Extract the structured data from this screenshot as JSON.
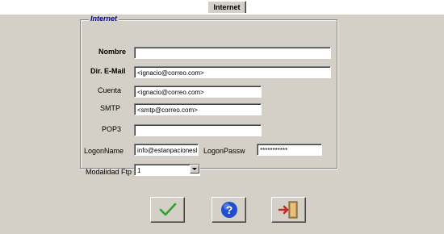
{
  "tab": {
    "label": "Internet"
  },
  "group": {
    "title": "Internet"
  },
  "fields": {
    "nombre": {
      "label": "Nombre",
      "value": ""
    },
    "email": {
      "label": "Dir. E-Mail",
      "value": "<ignacio@correo.com>"
    },
    "cuenta": {
      "label": "Cuenta",
      "value": "<ignacio@correo.com>"
    },
    "smtp": {
      "label": "SMTP",
      "value": "<smtp@correo.com>"
    },
    "pop3": {
      "label": "POP3",
      "value": ""
    },
    "logon_name": {
      "label": "LogonName",
      "value": "info@estanpacionesl"
    },
    "logon_passw": {
      "label": "LogonPassw",
      "value": "***********"
    },
    "modalidad_ftp": {
      "label": "Modalidad Ftp",
      "value": "1"
    }
  },
  "buttons": {
    "accept": {
      "icon": "checkmark-icon",
      "color": "#2fa12f"
    },
    "help": {
      "icon": "help-icon",
      "color": "#1f4fd0"
    },
    "exit": {
      "icon": "exit-door-icon",
      "color": "#c62828"
    }
  }
}
